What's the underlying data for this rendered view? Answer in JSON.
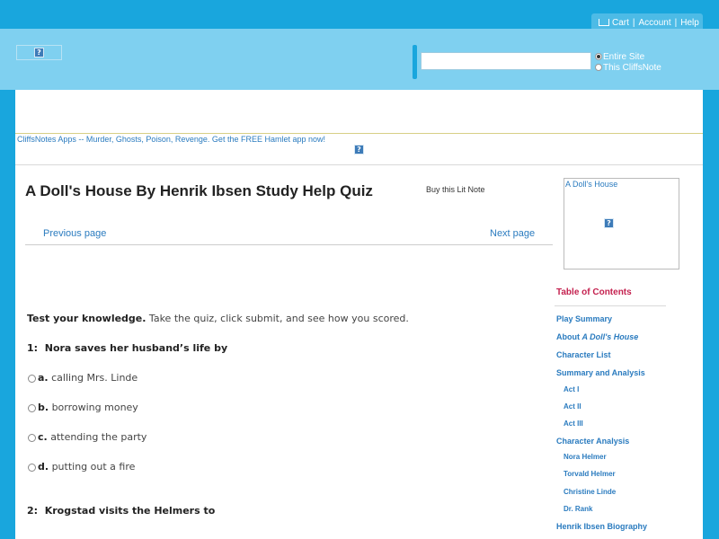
{
  "utility_nav": {
    "cart": "Cart",
    "account": "Account",
    "help": "Help",
    "separator": "|"
  },
  "search": {
    "value": "",
    "scope_options": [
      {
        "label": "Entire Site",
        "selected": true
      },
      {
        "label": "This CliffsNote",
        "selected": false
      }
    ]
  },
  "promo": {
    "text": "CliffsNotes Apps -- Murder, Ghosts, Poison, Revenge. Get the FREE Hamlet app now!"
  },
  "page": {
    "title": "A Doll's House By Henrik Ibsen Study Help Quiz",
    "buy_link": "Buy this Lit Note",
    "prev_link": "Previous page",
    "next_link": "Next page"
  },
  "quiz": {
    "intro_bold": "Test your knowledge.",
    "intro_rest": " Take the quiz, click submit, and see how you scored.",
    "questions": [
      {
        "label": "1:",
        "text": "Nora saves her husband’s life by",
        "options": [
          {
            "letter": "a.",
            "text": "calling Mrs. Linde"
          },
          {
            "letter": "b.",
            "text": "borrowing money"
          },
          {
            "letter": "c.",
            "text": "attending the party"
          },
          {
            "letter": "d.",
            "text": "putting out a fire"
          }
        ]
      },
      {
        "label": "2:",
        "text": "Krogstad visits the Helmers to"
      }
    ]
  },
  "sidebar": {
    "book_thumb_caption": "A Doll's House",
    "toc_title": "Table of Contents",
    "toc": {
      "play_summary": "Play Summary",
      "about_prefix": "About ",
      "about_title": "A Doll's House",
      "character_list": "Character List",
      "summary_analysis": "Summary and Analysis",
      "act1": "Act I",
      "act2": "Act II",
      "act3": "Act III",
      "character_analysis": "Character Analysis",
      "nora": "Nora Helmer",
      "torvald": "Torvald Helmer",
      "christine": "Christine Linde",
      "rank": "Dr. Rank",
      "biography": "Henrik Ibsen Biography"
    }
  },
  "colors": {
    "brand_blue": "#19a6dd",
    "header_light": "#7fd0f0",
    "link": "#2a7bbf",
    "toc_accent": "#c4214f"
  }
}
